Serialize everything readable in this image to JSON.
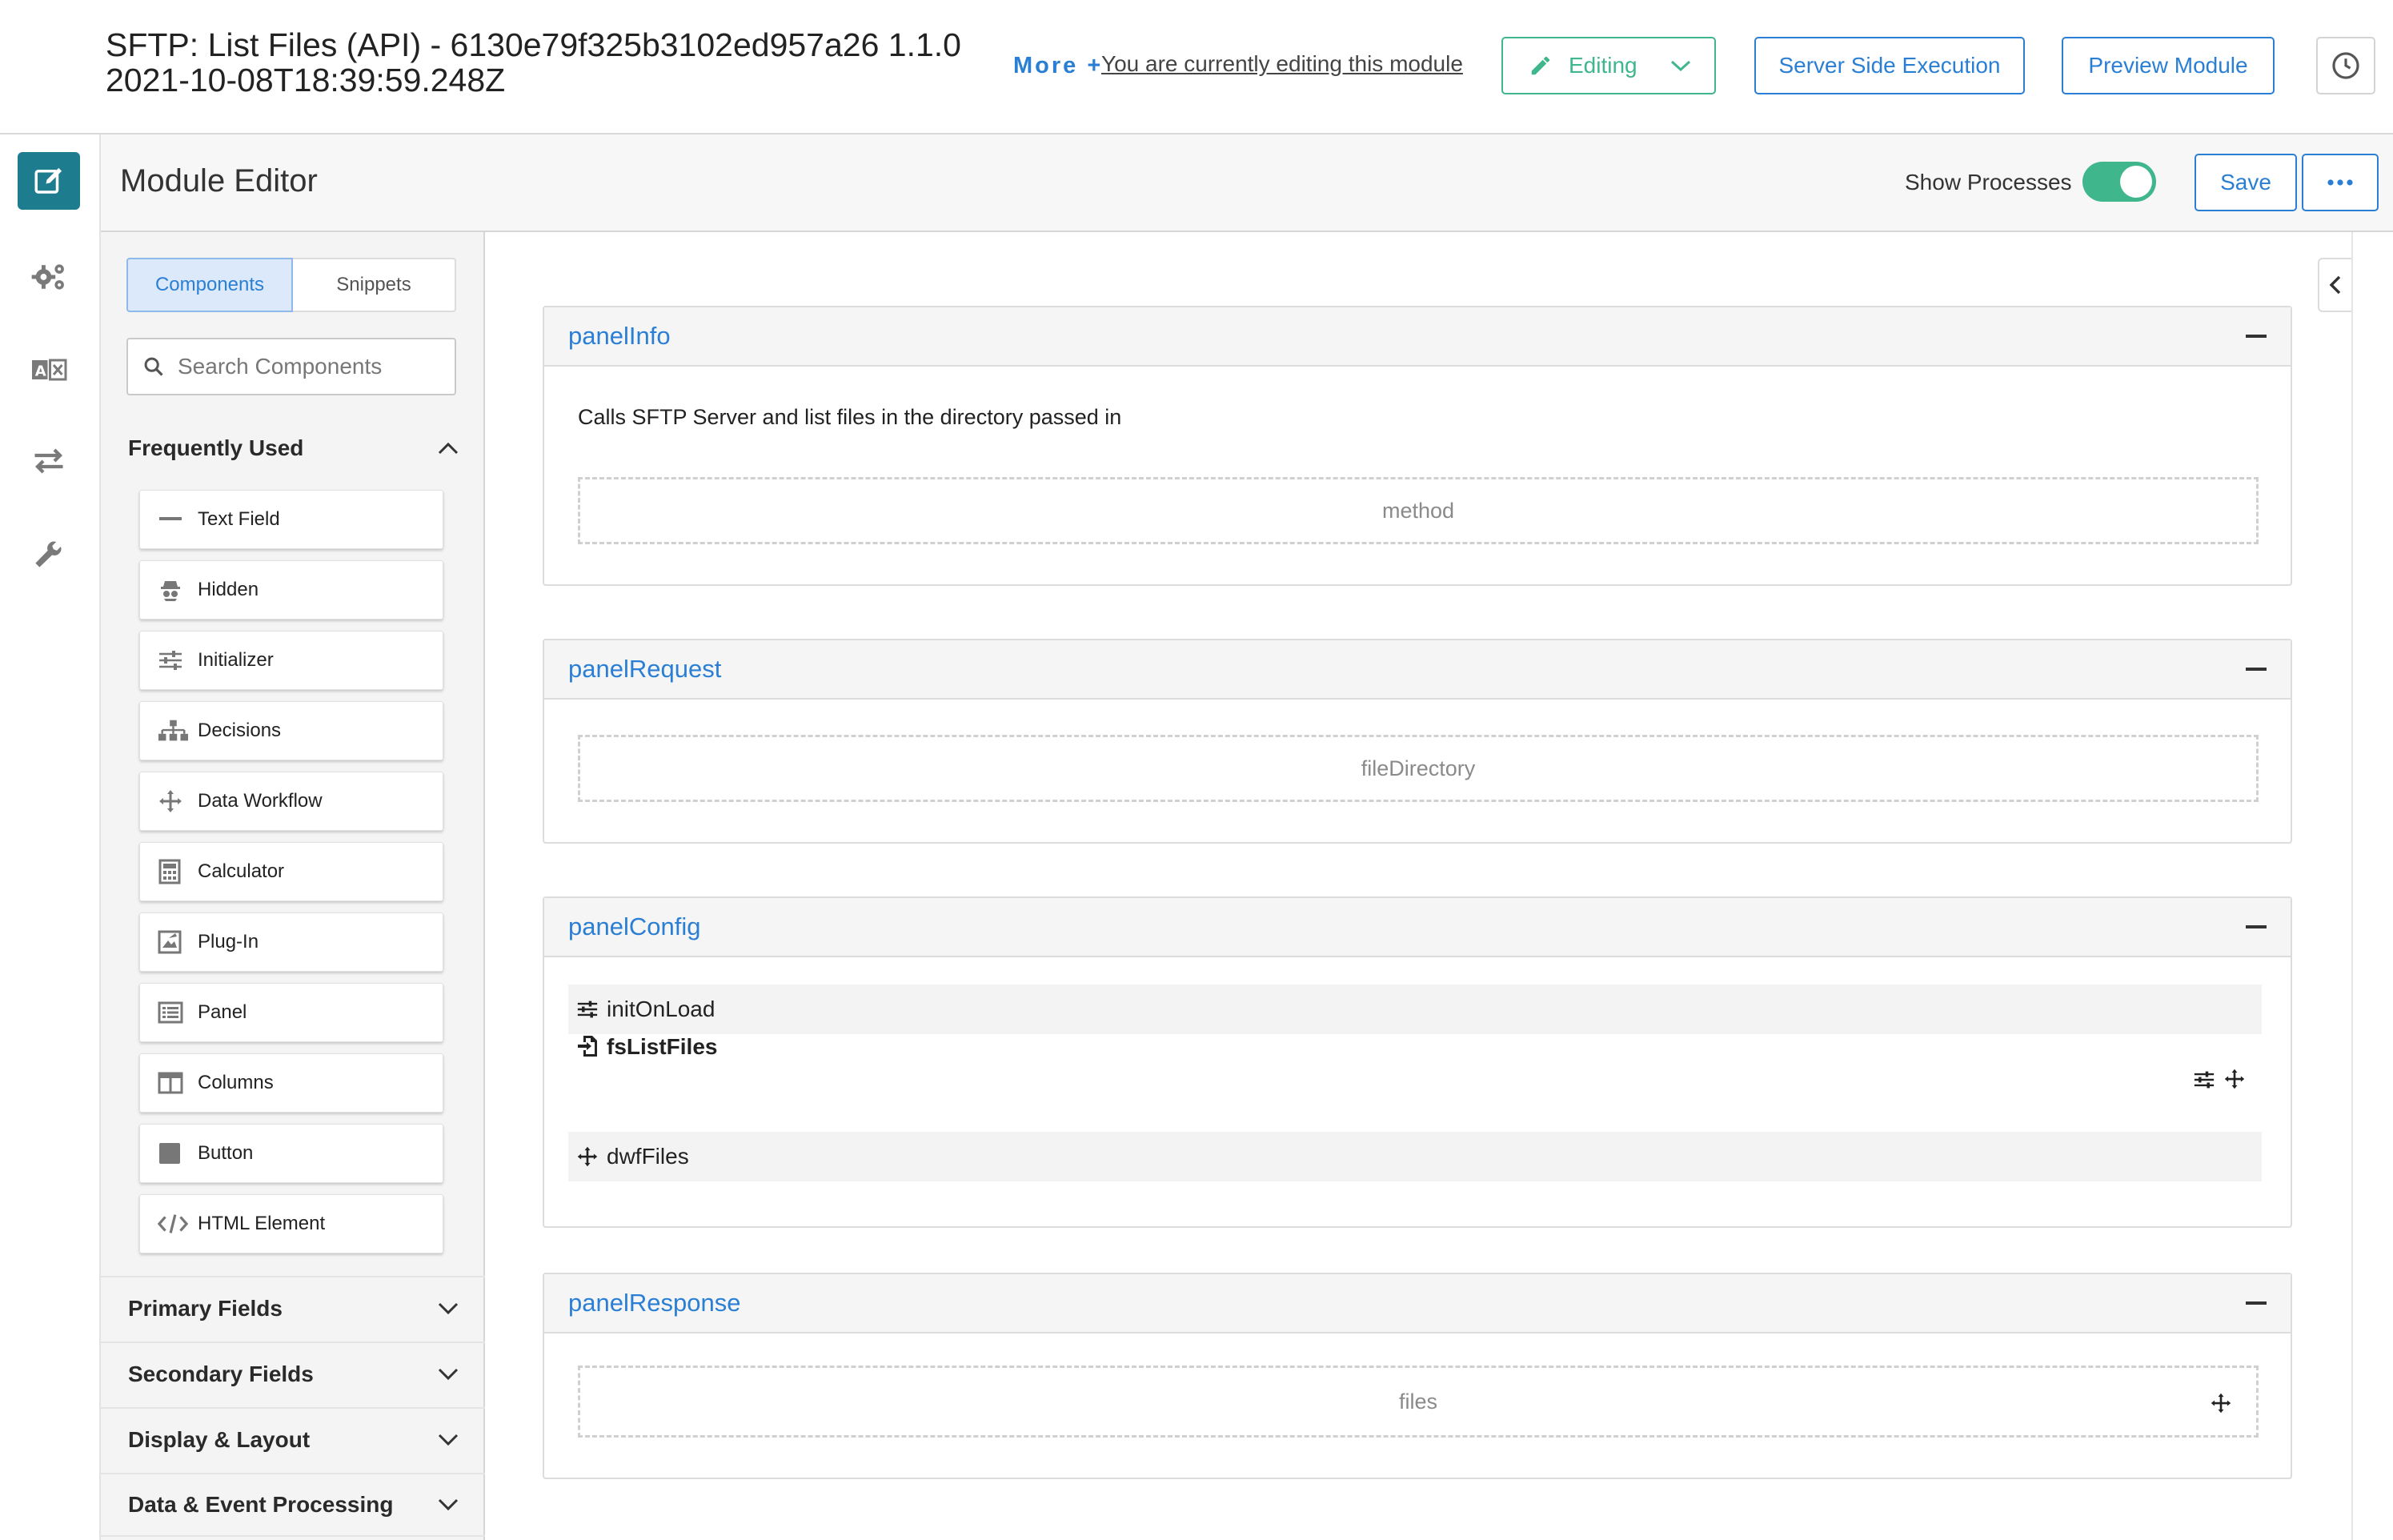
{
  "header": {
    "title_line1": "SFTP: List Files (API) - 6130e79f325b3102ed957a26 1.1.0",
    "title_line2": "2021-10-08T18:39:59.248Z",
    "more_link": "More +",
    "editing_message": "You are currently editing this module",
    "editing_label": "Editing",
    "server_side_label": "Server Side Execution",
    "preview_label": "Preview Module"
  },
  "editor": {
    "title": "Module Editor",
    "show_processes_label": "Show Processes",
    "show_processes_on": true,
    "save_label": "Save"
  },
  "sidebar": {
    "tabs": [
      "Components",
      "Snippets"
    ],
    "search_placeholder": "Search Components",
    "frequently_used": {
      "title": "Frequently Used",
      "items": [
        {
          "label": "Text Field",
          "icon": "text-field-icon"
        },
        {
          "label": "Hidden",
          "icon": "hidden-icon"
        },
        {
          "label": "Initializer",
          "icon": "initializer-icon"
        },
        {
          "label": "Decisions",
          "icon": "decisions-icon"
        },
        {
          "label": "Data Workflow",
          "icon": "data-workflow-icon"
        },
        {
          "label": "Calculator",
          "icon": "calculator-icon"
        },
        {
          "label": "Plug-In",
          "icon": "plug-in-icon"
        },
        {
          "label": "Panel",
          "icon": "panel-icon"
        },
        {
          "label": "Columns",
          "icon": "columns-icon"
        },
        {
          "label": "Button",
          "icon": "button-icon"
        },
        {
          "label": "HTML Element",
          "icon": "html-element-icon"
        }
      ]
    },
    "categories": [
      "Primary Fields",
      "Secondary Fields",
      "Display & Layout",
      "Data & Event Processing"
    ]
  },
  "canvas": {
    "panels": [
      {
        "title": "panelInfo",
        "description": "Calls SFTP Server and list files in the directory passed in",
        "fields": [
          "method"
        ]
      },
      {
        "title": "panelRequest",
        "fields": [
          "fileDirectory"
        ]
      },
      {
        "title": "panelConfig",
        "processes": [
          "initOnLoad",
          "fsListFiles",
          "dwfFiles"
        ]
      },
      {
        "title": "panelResponse",
        "fields": [
          "files"
        ]
      }
    ]
  },
  "colors": {
    "accent": "#2a7fd4",
    "editing_green": "#3fb68b",
    "rail_active": "#1d7d8f"
  }
}
